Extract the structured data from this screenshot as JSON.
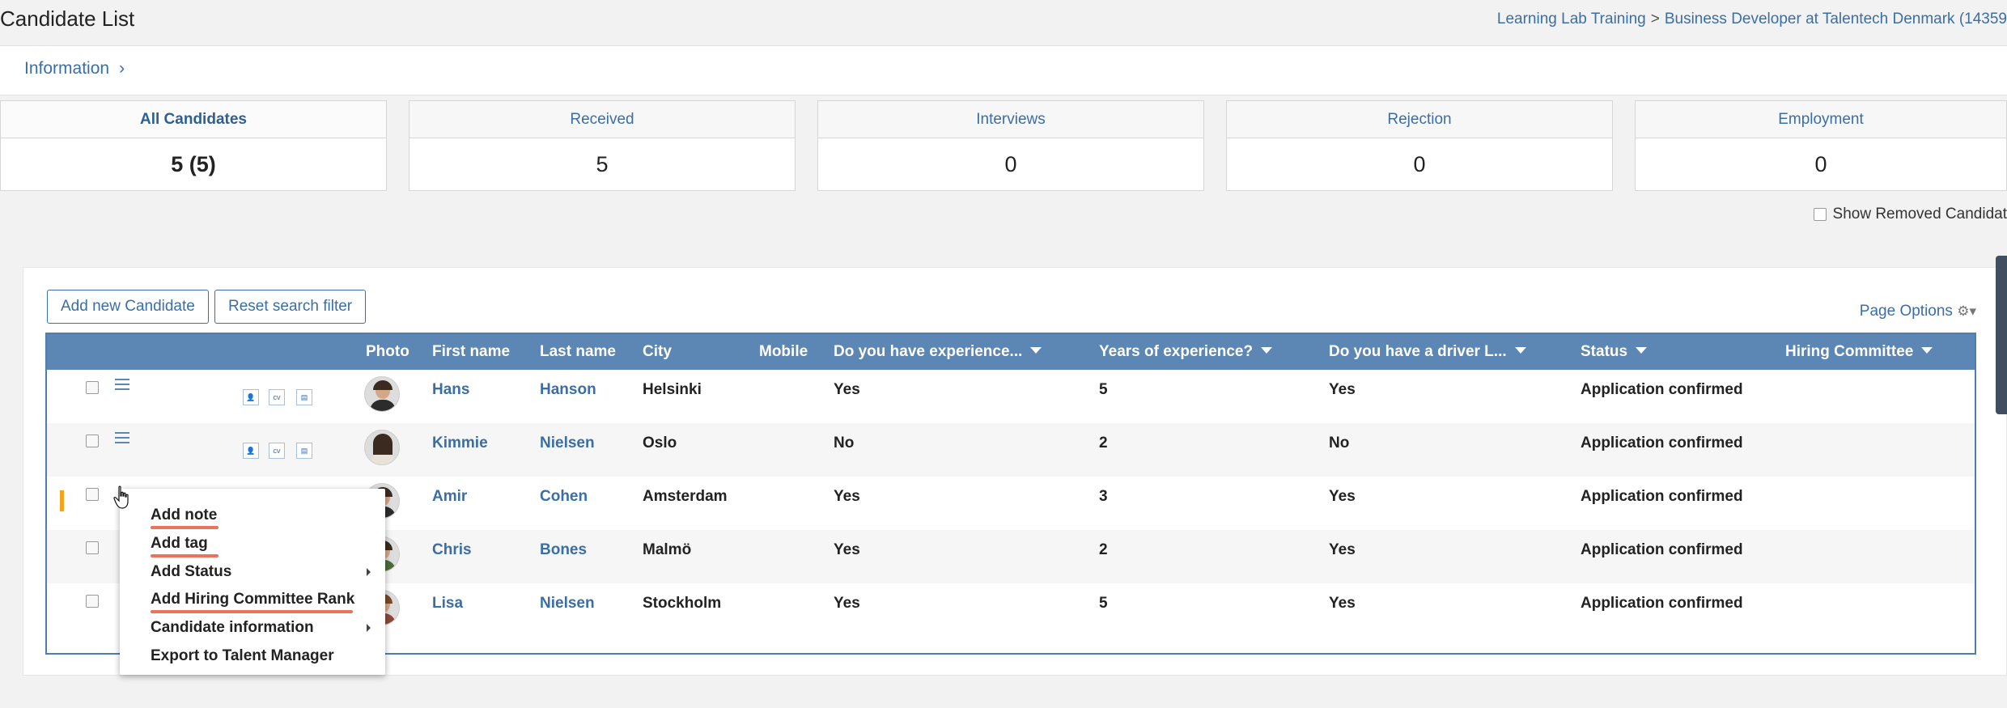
{
  "page": {
    "title": "Candidate List",
    "breadcrumb": {
      "company": "Learning Lab Training",
      "separator": ">",
      "job": "Business Developer at Talentech Denmark (14359"
    }
  },
  "info": {
    "label": "Information",
    "chevron": "›"
  },
  "stats": [
    {
      "label": "All Candidates",
      "value": "5 (5)"
    },
    {
      "label": "Received",
      "value": "5"
    },
    {
      "label": "Interviews",
      "value": "0"
    },
    {
      "label": "Rejection",
      "value": "0"
    },
    {
      "label": "Employment",
      "value": "0"
    }
  ],
  "show_removed_label": "Show Removed Candidat",
  "toolbar": {
    "add_new": "Add new Candidate",
    "reset_filter": "Reset search filter",
    "page_options": "Page Options"
  },
  "table": {
    "headers": {
      "photo": "Photo",
      "first_name": "First name",
      "last_name": "Last name",
      "city": "City",
      "mobile": "Mobile",
      "experience": "Do you have experience...",
      "years": "Years of experience?",
      "driver": "Do you have a driver L...",
      "status": "Status",
      "hiring": "Hiring Committee"
    },
    "doc_icons": {
      "profile": "👤",
      "cv": "cv",
      "doc": "▤"
    },
    "rows": [
      {
        "first": "Hans",
        "last": "Hanson",
        "city": "Helsinki",
        "experience": "Yes",
        "years": "5",
        "driver": "Yes",
        "status": "Application confirmed"
      },
      {
        "first": "Kimmie",
        "last": "Nielsen",
        "city": "Oslo",
        "experience": "No",
        "years": "2",
        "driver": "No",
        "status": "Application confirmed"
      },
      {
        "first": "Amir",
        "last": "Cohen",
        "city": "Amsterdam",
        "experience": "Yes",
        "years": "3",
        "driver": "Yes",
        "status": "Application confirmed"
      },
      {
        "first": "Chris",
        "last": "Bones",
        "city": "Malmö",
        "experience": "Yes",
        "years": "2",
        "driver": "Yes",
        "status": "Application confirmed"
      },
      {
        "first": "Lisa",
        "last": "Nielsen",
        "city": "Stockholm",
        "experience": "Yes",
        "years": "5",
        "driver": "Yes",
        "status": "Application confirmed"
      }
    ]
  },
  "context_menu": {
    "items": [
      {
        "label": "Add note",
        "highlighted": true,
        "submenu": false
      },
      {
        "label": "Add tag",
        "highlighted": true,
        "submenu": false
      },
      {
        "label": "Add Status",
        "highlighted": false,
        "submenu": true
      },
      {
        "label": "Add Hiring Committee Rank",
        "highlighted": true,
        "submenu": false
      },
      {
        "label": "Candidate information",
        "highlighted": false,
        "submenu": true
      },
      {
        "label": "Export to Talent Manager",
        "highlighted": false,
        "submenu": false
      }
    ],
    "highlight_color": "#e8745c"
  },
  "colors": {
    "accent": "#3a6ea5",
    "table_header": "#5c86b4",
    "marker": "#f3a41c"
  }
}
